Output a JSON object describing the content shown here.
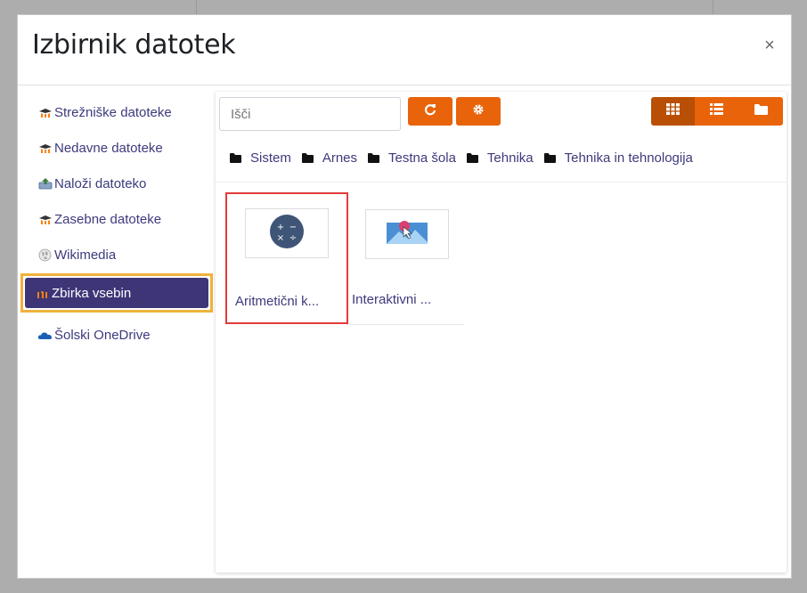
{
  "dialog": {
    "title": "Izbirnik datotek",
    "close_icon": "×"
  },
  "repositories": [
    {
      "label": "Strežniške datoteke",
      "icon": "moodle-hat-icon"
    },
    {
      "label": "Nedavne datoteke",
      "icon": "moodle-hat-icon"
    },
    {
      "label": "Naloži datoteko",
      "icon": "upload-icon"
    },
    {
      "label": "Zasebne datoteke",
      "icon": "moodle-hat-icon"
    },
    {
      "label": "Wikimedia",
      "icon": "wikimedia-globe-icon"
    },
    {
      "label": "Zbirka vsebin",
      "icon": "content-bank-icon",
      "active": true
    },
    {
      "label": "Šolski OneDrive",
      "icon": "onedrive-cloud-icon"
    }
  ],
  "toolbar": {
    "search_placeholder": "Išči",
    "refresh_icon": "refresh-icon",
    "settings_icon": "gear-icon",
    "views": [
      "grid-view-icon",
      "list-view-icon",
      "folder-view-icon"
    ],
    "active_view": "grid"
  },
  "breadcrumb": [
    "Sistem",
    "Arnes",
    "Testna šola",
    "Tehnika",
    "Tehnika in tehnologija"
  ],
  "files": [
    {
      "name": "Aritmetični k...",
      "icon": "arithmetic-quiz-icon",
      "selected": true
    },
    {
      "name": "Interaktivni ...",
      "icon": "interactive-image-icon",
      "selected": false
    }
  ],
  "colors": {
    "accent_orange": "#e8630a",
    "active_view_orange": "#b94f05",
    "active_repo_purple": "#3e3577",
    "link_purple": "#3d3a7d",
    "highlight_yellow": "#f0b23b",
    "selection_red": "#e33b3b"
  }
}
